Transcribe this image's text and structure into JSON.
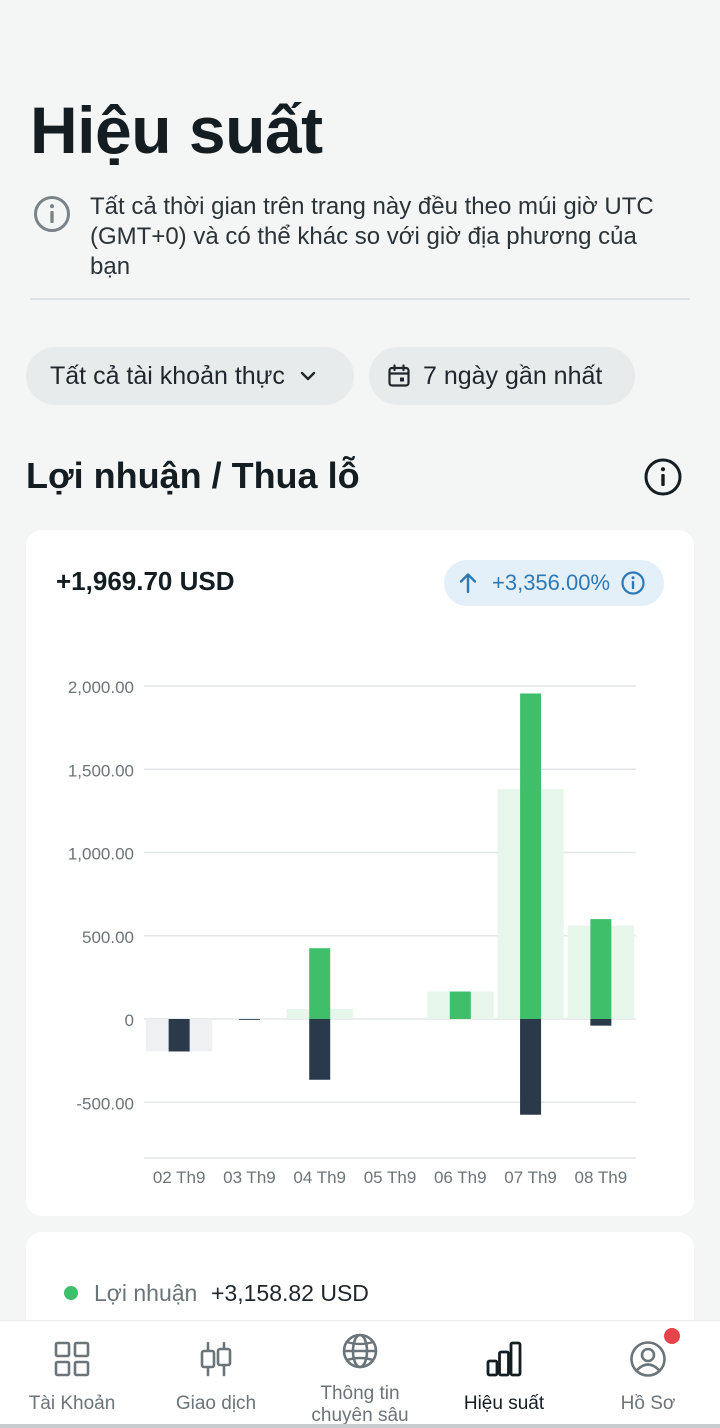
{
  "page": {
    "title": "Hiệu suất"
  },
  "notice": {
    "text": "Tất cả thời gian trên trang này đều theo múi giờ UTC (GMT+0) và có thể khác so với giờ địa phương của bạn",
    "icon": "info-icon"
  },
  "filters": {
    "account": "Tất cả tài khoản thực",
    "date_range": "7 ngày gần nhất"
  },
  "section": {
    "title": "Lợi nhuận / Thua lỗ"
  },
  "summary": {
    "total": "+1,969.70 USD",
    "change": "+3,356.00%"
  },
  "colors": {
    "profit": "#3fbf6a",
    "loss": "#2b3a4a",
    "net": "#e6f6ea",
    "net_negative": "#eef0f2",
    "accent": "#2d79b6"
  },
  "chart_data": {
    "type": "bar",
    "categories": [
      "02 Th9",
      "03 Th9",
      "04 Th9",
      "05 Th9",
      "06 Th9",
      "07 Th9",
      "08 Th9"
    ],
    "y_ticks": [
      "2,000.00",
      "1,500.00",
      "1,000.00",
      "500.00",
      "0",
      "-500.00"
    ],
    "y_tick_values": [
      2000,
      1500,
      1000,
      500,
      0,
      -500
    ],
    "ylim": [
      -500,
      2000
    ],
    "grid": true,
    "series": [
      {
        "name": "Lợi nhuận",
        "values": [
          0,
          0,
          425,
          0,
          165,
          1955,
          600
        ]
      },
      {
        "name": "Thua lỗ",
        "values": [
          -195,
          -5,
          -365,
          0,
          0,
          -575,
          -40
        ]
      }
    ],
    "net": [
      -195,
      -5,
      60,
      0,
      165,
      1380,
      560
    ]
  },
  "legend": {
    "label": "Lợi nhuận",
    "value": "+3,158.82 USD"
  },
  "nav": [
    {
      "label": "Tài Khoản",
      "icon": "accounts-grid-icon"
    },
    {
      "label": "Giao dịch",
      "icon": "trade-candles-icon"
    },
    {
      "label": "Thông tin chuyên sâu",
      "icon": "globe-icon"
    },
    {
      "label": "Hiệu suất",
      "icon": "bar-chart-icon"
    },
    {
      "label": "Hồ Sơ",
      "icon": "profile-icon"
    }
  ]
}
